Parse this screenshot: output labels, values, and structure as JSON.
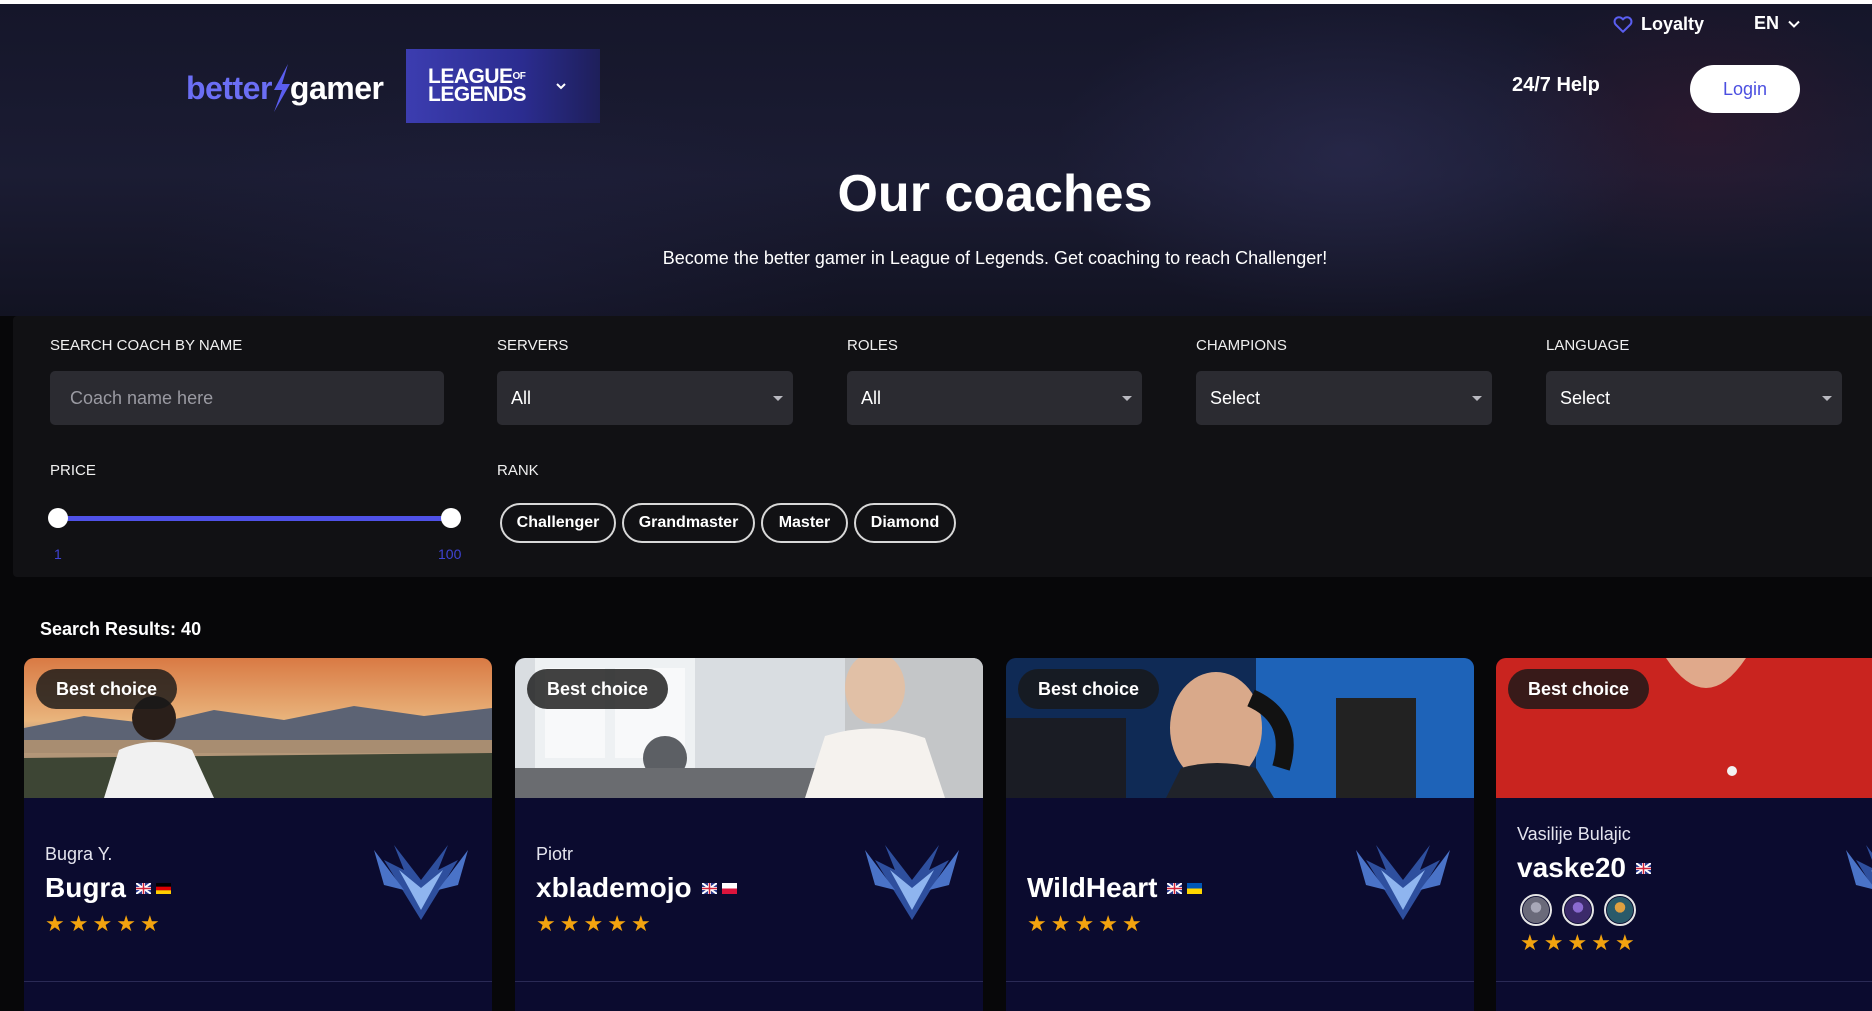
{
  "header": {
    "loyalty_label": "Loyalty",
    "language": "EN",
    "logo_better": "better",
    "logo_gamer": "gamer",
    "game_line1": "LEAGUE",
    "game_of": "OF",
    "game_line2": "LEGENDS",
    "help_label": "24/7 Help",
    "login_label": "Login"
  },
  "hero": {
    "title": "Our coaches",
    "subtitle": "Become the better gamer in League of Legends. Get coaching to reach Challenger!"
  },
  "filters": {
    "search_label": "SEARCH COACH BY NAME",
    "search_placeholder": "Coach name here",
    "servers_label": "SERVERS",
    "servers_value": "All",
    "roles_label": "ROLES",
    "roles_value": "All",
    "champions_label": "CHAMPIONS",
    "champions_value": "Select",
    "language_label": "LANGUAGE",
    "language_value": "Select",
    "price_label": "PRICE",
    "price_min": "1",
    "price_max": "100",
    "rank_label": "RANK",
    "ranks": [
      "Challenger",
      "Grandmaster",
      "Master",
      "Diamond"
    ]
  },
  "results": {
    "label": "Search Results: 40"
  },
  "coaches": [
    {
      "badge": "Best choice",
      "real_name": "Bugra Y.",
      "nick": "Bugra",
      "rating": 5
    },
    {
      "badge": "Best choice",
      "real_name": "Piotr",
      "nick": "xblademojo",
      "rating": 5
    },
    {
      "badge": "Best choice",
      "real_name": "",
      "nick": "WildHeart",
      "rating": 5
    },
    {
      "badge": "Best choice",
      "real_name": "Vasilije Bulajic",
      "nick": "vaske20",
      "rating": 5
    }
  ],
  "colors": {
    "accent": "#4f52e8",
    "star": "#f2a30f",
    "card_bg": "#0b0b2f"
  }
}
